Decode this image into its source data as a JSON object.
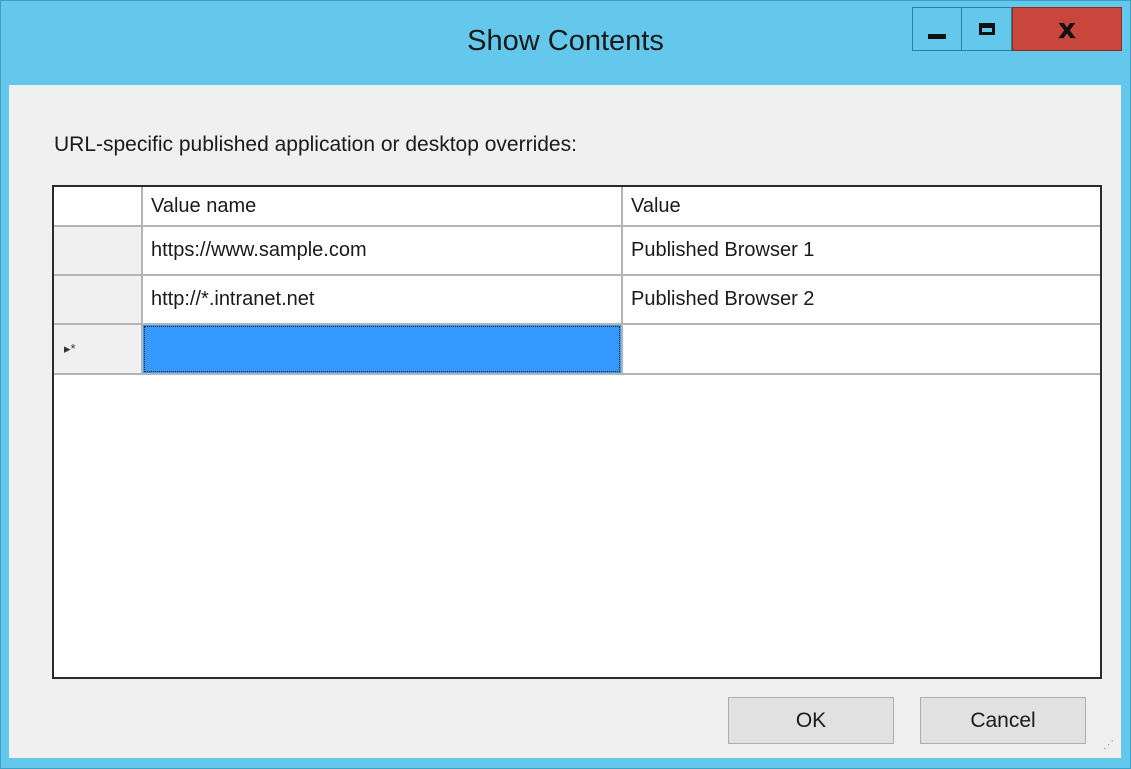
{
  "window": {
    "title": "Show Contents",
    "controls": {
      "minimize": "minimize",
      "maximize": "maximize",
      "close": "x"
    }
  },
  "dialog": {
    "prompt": "URL-specific published application or desktop overrides:",
    "table": {
      "columns": [
        "Value name",
        "Value"
      ],
      "rows": [
        {
          "name": "https://www.sample.com",
          "value": "Published Browser 1"
        },
        {
          "name": "http://*.intranet.net",
          "value": "Published Browser 2"
        }
      ],
      "new_row_marker": "▸*"
    },
    "buttons": {
      "ok": "OK",
      "cancel": "Cancel"
    }
  },
  "colors": {
    "titlebar": "#63c8eb",
    "close": "#c9463d",
    "selection": "#3399ff"
  }
}
